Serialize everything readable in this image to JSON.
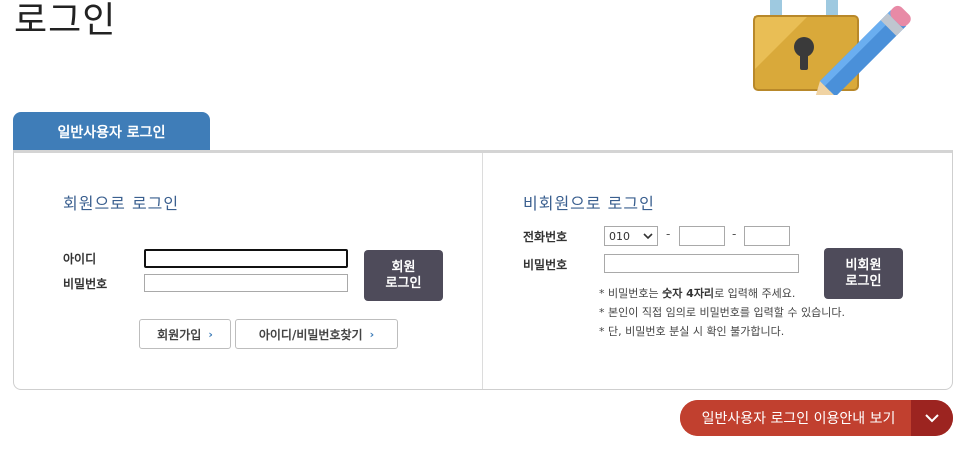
{
  "page": {
    "title": "로그인"
  },
  "tab": {
    "label": "일반사용자 로그인"
  },
  "member": {
    "title": "회원으로 로그인",
    "id_label": "아이디",
    "pw_label": "비밀번호",
    "id_value": "",
    "pw_value": "",
    "login_button_line1": "회원",
    "login_button_line2": "로그인",
    "join_button": "회원가입",
    "find_button": "아이디/비밀번호찾기"
  },
  "guest": {
    "title": "비회원으로 로그인",
    "phone_label": "전화번호",
    "phone_prefix": "010",
    "phone_dash": "-",
    "pw_label": "비밀번호",
    "login_button_line1": "비회원",
    "login_button_line2": "로그인",
    "note1_prefix": "* 비밀번호는 ",
    "note1_bold": "숫자 4자리",
    "note1_suffix": "로 입력해 주세요.",
    "note2": "* 본인이 직접 임의로 비밀번호를 입력할 수 있습니다.",
    "note3": "* 단, 비밀번호 분실 시 확인 불가합니다."
  },
  "guide": {
    "label": "일반사용자 로그인 이용안내 보기"
  },
  "colors": {
    "tab": "#3f7db8",
    "dark_button": "#4e4b5a",
    "guide": "#c1402f",
    "guide_arrow": "#9c2420"
  },
  "icons": [
    "lock-pencil-illustration",
    "chevron-right-icon",
    "chevron-down-icon"
  ]
}
